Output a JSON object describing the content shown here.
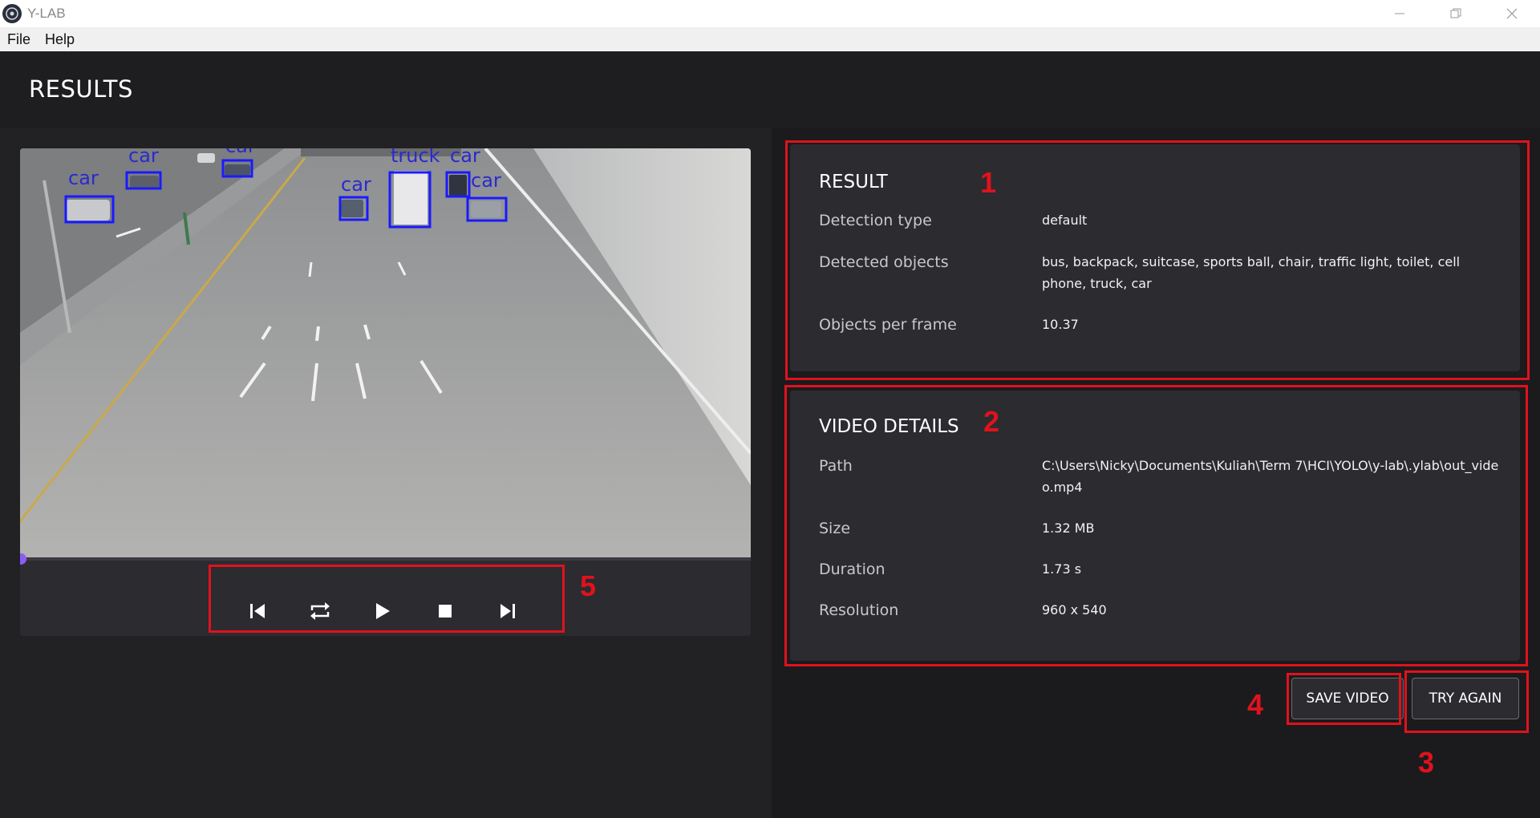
{
  "window": {
    "title": "Y-LAB",
    "controls": [
      "minimize",
      "restore",
      "close"
    ]
  },
  "menu": {
    "items": [
      "File",
      "Help"
    ]
  },
  "header": {
    "title": "RESULTS"
  },
  "video": {
    "detections": [
      {
        "label": "car"
      },
      {
        "label": "car"
      },
      {
        "label": "car"
      },
      {
        "label": "car"
      },
      {
        "label": "truck"
      },
      {
        "label": "car"
      },
      {
        "label": "car"
      }
    ],
    "progress": 0.0,
    "box_color": "#1a1aff",
    "progress_color": "#8b5cf6",
    "controls": [
      "skip-previous-icon",
      "repeat-icon",
      "play-icon",
      "stop-icon",
      "skip-next-icon"
    ]
  },
  "result": {
    "title": "RESULT",
    "rows": [
      {
        "label": "Detection type",
        "value": "default"
      },
      {
        "label": "Detected objects",
        "value": "bus, backpack, suitcase, sports ball, chair, traffic light, toilet, cell phone, truck, car"
      },
      {
        "label": "Objects per frame",
        "value": "10.37"
      }
    ]
  },
  "video_details": {
    "title": "VIDEO DETAILS",
    "rows": [
      {
        "label": "Path",
        "value": "C:\\Users\\Nicky\\Documents\\Kuliah\\Term 7\\HCI\\YOLO\\y-lab\\.ylab\\out_video.mp4"
      },
      {
        "label": "Size",
        "value": "1.32 MB"
      },
      {
        "label": "Duration",
        "value": "1.73 s"
      },
      {
        "label": "Resolution",
        "value": "960 x 540"
      }
    ]
  },
  "actions": {
    "save_label": "SAVE VIDEO",
    "retry_label": "TRY AGAIN"
  },
  "annotations": {
    "color": "#e0121c",
    "labels": [
      "1",
      "2",
      "3",
      "4",
      "5"
    ]
  }
}
